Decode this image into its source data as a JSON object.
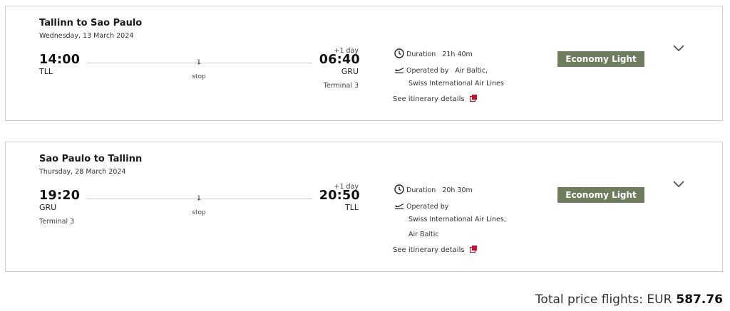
{
  "flights": [
    {
      "title": "Tallinn to Sao Paulo",
      "date": "Wednesday, 13 March 2024",
      "dep_time": "14:00",
      "dep_code": "TLL",
      "dep_terminal": "",
      "stops_num": "1",
      "stops_label": "stop",
      "arr_plus": "+1 day",
      "arr_time": "06:40",
      "arr_code": "GRU",
      "arr_terminal": "Terminal 3",
      "duration_label": "Duration",
      "duration": "21h 40m",
      "operated_label": "Operated by",
      "operator_line1": "Air Baltic,",
      "operator_line2": "Swiss International Air Lines",
      "itinerary_link": "See itinerary details",
      "fare": "Economy Light"
    },
    {
      "title": "Sao Paulo to Tallinn",
      "date": "Thursday, 28 March 2024",
      "dep_time": "19:20",
      "dep_code": "GRU",
      "dep_terminal": "Terminal 3",
      "stops_num": "1",
      "stops_label": "stop",
      "arr_plus": "+1 day",
      "arr_time": "20:50",
      "arr_code": "TLL",
      "arr_terminal": "",
      "duration_label": "Duration",
      "duration": "20h 30m",
      "operated_label": "Operated by",
      "operator_line1": "Swiss International Air Lines,",
      "operator_line2": "Air Baltic",
      "itinerary_link": "See itinerary details",
      "fare": "Economy Light"
    }
  ],
  "total": {
    "label": "Total price flights: EUR",
    "amount": "587.76"
  },
  "colors": {
    "badge": "#6e7d5d",
    "link_icon": "#c8102e"
  },
  "icons": {
    "duration": "clock-icon",
    "operator": "plane-takeoff-icon",
    "link": "external-link-icon",
    "expand": "chevron-down-icon"
  }
}
